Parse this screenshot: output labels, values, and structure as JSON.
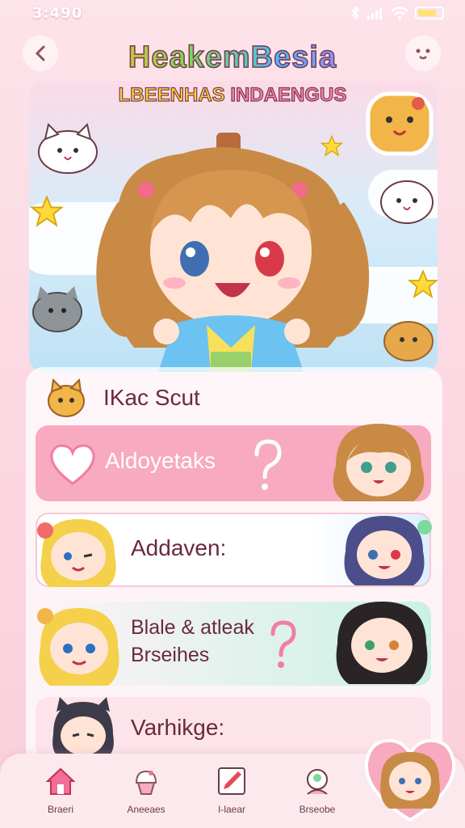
{
  "status_bar": {
    "time": "3:490"
  },
  "header": {
    "title_line1": "HeakemBesia",
    "title_line2_a": "LBEENHAS",
    "title_line2_b": "INDAENGUS"
  },
  "cards": [
    {
      "label": "IKac Scut"
    },
    {
      "label": "Aldoyetaks"
    },
    {
      "label": "Addaven:"
    },
    {
      "label_line1": "Blale & atleak",
      "label_line2": "Brseihes"
    },
    {
      "label": "Varhikge:"
    }
  ],
  "nav": [
    {
      "label": "Braeri"
    },
    {
      "label": "Aneeaes"
    },
    {
      "label": "I-laear"
    },
    {
      "label": "Brseobe"
    }
  ],
  "colors": {
    "accent_pink": "#f7aac0",
    "mint": "#c9f1e4",
    "blue_tint": "#dcefff",
    "text": "#6a2a3c"
  }
}
